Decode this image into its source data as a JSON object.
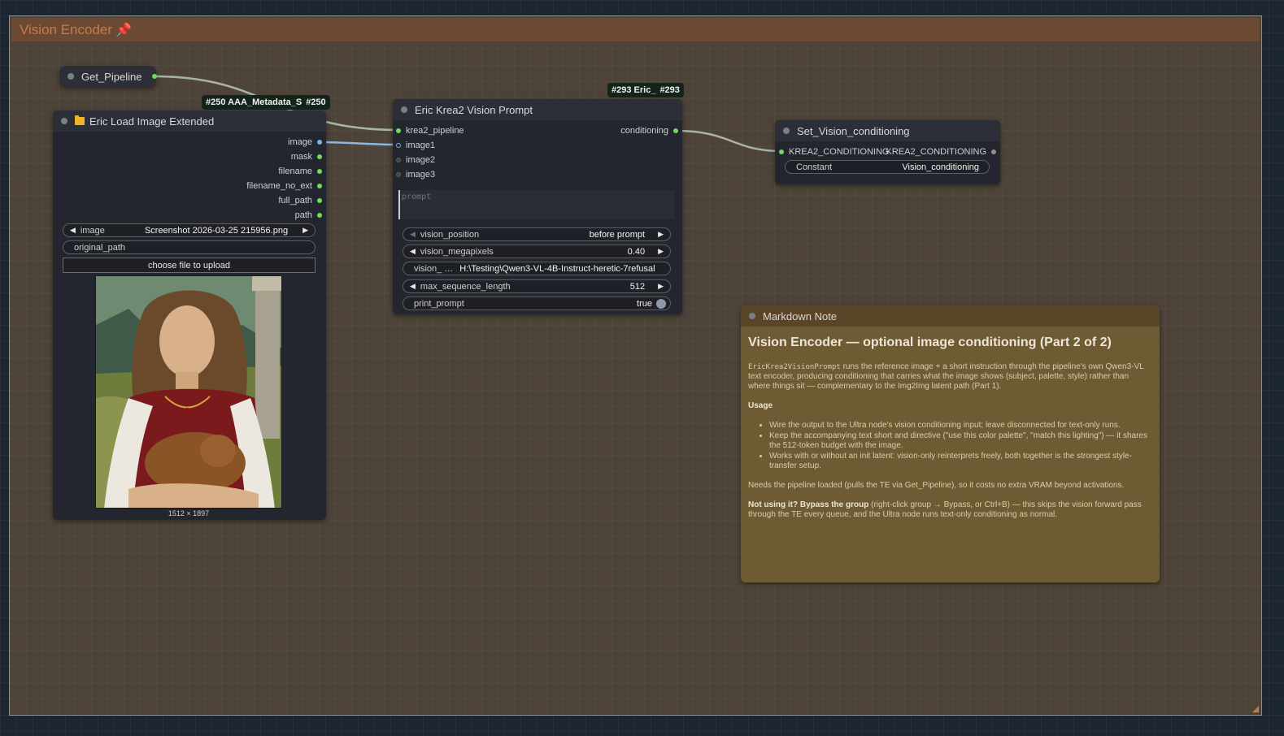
{
  "group": {
    "title": "Vision Encoder"
  },
  "get_pipeline": {
    "title": "Get_Pipeline"
  },
  "badges": {
    "metadata": {
      "text": "#250 AAA_Metadata_S",
      "id": "#250"
    },
    "krea": {
      "text": "#293 Eric_",
      "id": "#293"
    }
  },
  "load_image": {
    "title": "Eric Load Image Extended",
    "outputs": [
      "image",
      "mask",
      "filename",
      "filename_no_ext",
      "full_path",
      "path"
    ],
    "image_widget": {
      "label": "image",
      "value": "Screenshot 2026-03-25 215956.png"
    },
    "original_path_widget": {
      "label": "original_path"
    },
    "upload_button": "choose file to upload",
    "image_dimensions": "1512 × 1897"
  },
  "vision_prompt": {
    "title": "Eric Krea2 Vision Prompt",
    "inputs": [
      "krea2_pipeline",
      "image1",
      "image2",
      "image3"
    ],
    "output": "conditioning",
    "prompt_placeholder": "prompt",
    "widgets": {
      "vision_position": {
        "label": "vision_position",
        "value": "before prompt"
      },
      "vision_megapixels": {
        "label": "vision_megapixels",
        "value": "0.40"
      },
      "vision_model": {
        "label": "vision_ …",
        "value": "H:\\Testing\\Qwen3-VL-4B-Instruct-heretic-7refusal"
      },
      "max_sequence_length": {
        "label": "max_sequence_length",
        "value": "512"
      },
      "print_prompt": {
        "label": "print_prompt",
        "value": "true"
      }
    }
  },
  "set_vision": {
    "title": "Set_Vision_conditioning",
    "input": "KREA2_CONDITIONING",
    "output": "KREA2_CONDITIONING",
    "constant_widget": {
      "label": "Constant",
      "value": "Vision_conditioning"
    }
  },
  "note": {
    "header": "Markdown Note",
    "title": "Vision Encoder — optional image conditioning (Part 2 of 2)",
    "intro_code": "EricKrea2VisionPrompt",
    "intro_text": " runs the reference image + a short instruction through the pipeline's own Qwen3-VL text encoder, producing conditioning that carries what the image shows (subject, palette, style) rather than where things sit — complementary to the Img2Img latent path (Part 1).",
    "usage_heading": "Usage",
    "usage_items": [
      "Wire the output to the Ultra node's vision conditioning input; leave disconnected for text-only runs.",
      "Keep the accompanying text short and directive (\"use this color palette\", \"match this lighting\") — it shares the 512-token budget with the image.",
      "Works with or without an init latent: vision-only reinterprets freely, both together is the strongest style-transfer setup."
    ],
    "pipeline_text": "Needs the pipeline loaded (pulls the TE via Get_Pipeline), so it costs no extra VRAM beyond activations.",
    "bypass_bold": "Not using it? Bypass the group",
    "bypass_text": " (right-click group → Bypass, or Ctrl+B) — this skips the vision forward pass through the TE every queue, and the Ultra node runs text-only conditioning as normal."
  },
  "colors": {
    "group_bg": "#4d4338",
    "group_title": "#c87a4a",
    "node_bg": "#23262e",
    "note_bg": "#6e5b33",
    "slot_green": "#6fdc5a",
    "slot_blue": "#7fb0e6"
  }
}
